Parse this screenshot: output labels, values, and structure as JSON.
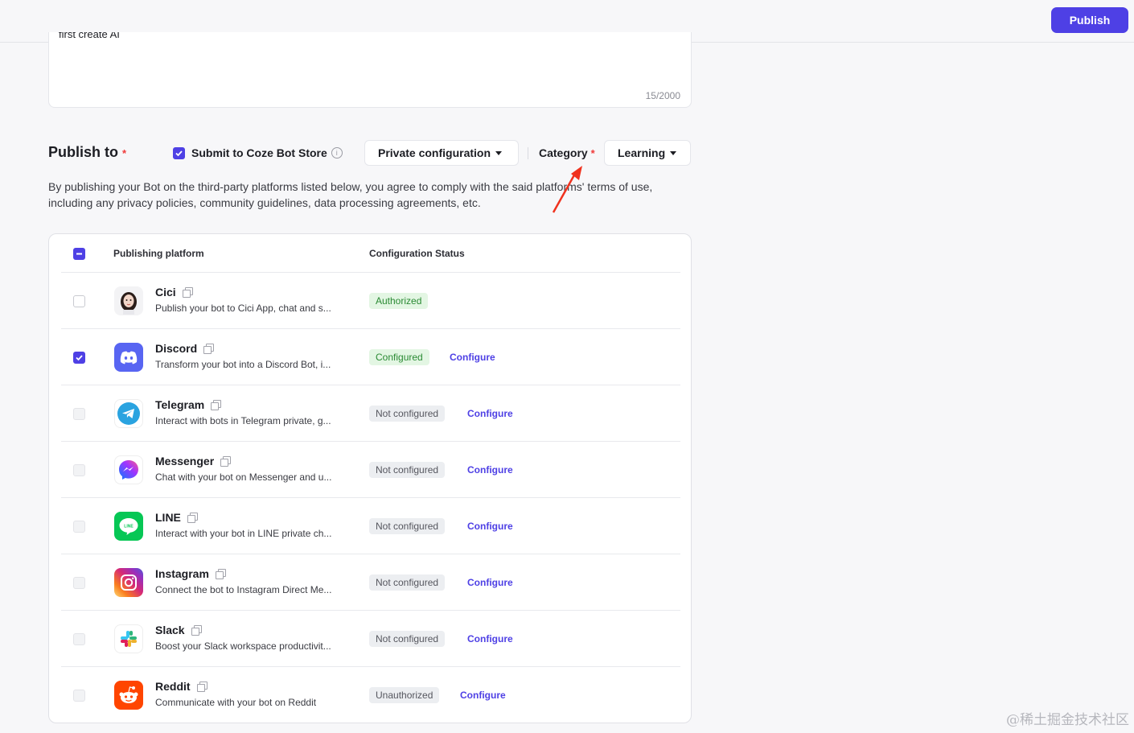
{
  "header": {
    "publish_label": "Publish"
  },
  "description_box": {
    "counter": "15/2000",
    "partial_text": "first create AI"
  },
  "publish_to": {
    "title": "Publish to",
    "required_mark": "*",
    "store_label": "Submit to Coze Bot Store",
    "config_dropdown": "Private configuration",
    "category_label": "Category",
    "category_value": "Learning"
  },
  "notice": "By publishing your Bot on the third-party platforms listed below, you agree to comply with the said platforms' terms of use, including any privacy policies, community guidelines, data processing agreements, etc.",
  "table": {
    "col_platform": "Publishing platform",
    "col_status": "Configuration Status",
    "rows": [
      {
        "name": "Cici",
        "desc": "Publish your bot to Cici App, chat and s...",
        "status": "Authorized",
        "configure": ""
      },
      {
        "name": "Discord",
        "desc": "Transform your bot into a Discord Bot, i...",
        "status": "Configured",
        "configure": "Configure"
      },
      {
        "name": "Telegram",
        "desc": "Interact with bots in Telegram private, g...",
        "status": "Not configured",
        "configure": "Configure"
      },
      {
        "name": "Messenger",
        "desc": "Chat with your bot on Messenger and u...",
        "status": "Not configured",
        "configure": "Configure"
      },
      {
        "name": "LINE",
        "desc": "Interact with your bot in LINE private ch...",
        "status": "Not configured",
        "configure": "Configure"
      },
      {
        "name": "Instagram",
        "desc": "Connect the bot to Instagram Direct Me...",
        "status": "Not configured",
        "configure": "Configure"
      },
      {
        "name": "Slack",
        "desc": "Boost your Slack workspace productivit...",
        "status": "Not configured",
        "configure": "Configure"
      },
      {
        "name": "Reddit",
        "desc": "Communicate with your bot on Reddit",
        "status": "Unauthorized",
        "configure": "Configure"
      }
    ]
  },
  "watermark": "@稀土掘金技术社区",
  "colors": {
    "accent": "#4e40e5",
    "required": "#f03a3a",
    "arrow": "#f0321e"
  }
}
